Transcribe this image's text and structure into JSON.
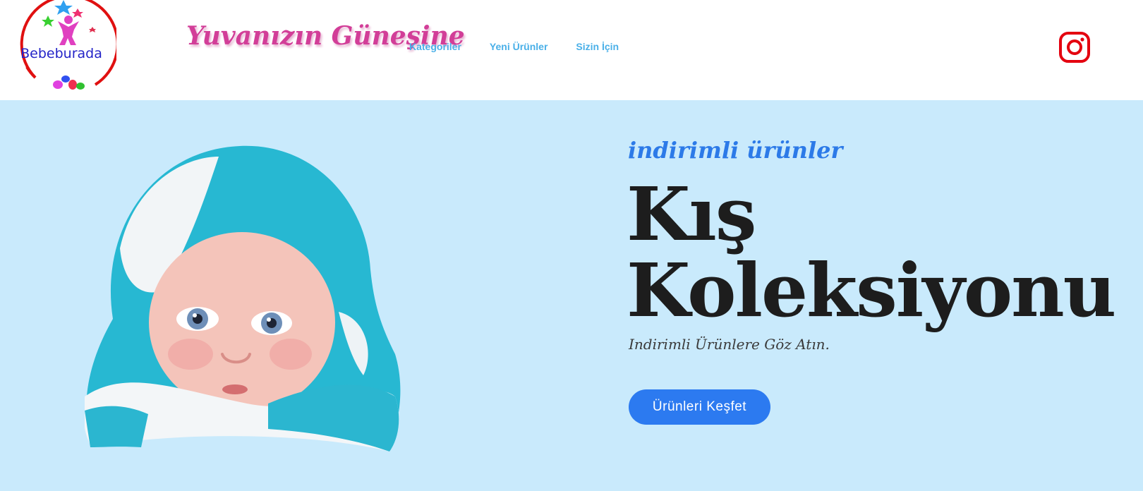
{
  "brand": {
    "logo_text": "Bebeburada",
    "tagline": "Yuvanızın Güneşine"
  },
  "nav": {
    "items": [
      {
        "label": "Kategoriler"
      },
      {
        "label": "Yeni Ürünler"
      },
      {
        "label": "Sizin İçin"
      }
    ]
  },
  "social": {
    "icon": "instagram-icon",
    "color": "#e4000f"
  },
  "hero": {
    "eyebrow": "indirimli ürünler",
    "headline_line1": "Kış",
    "headline_line2": "Koleksiyonu",
    "subhead": "Indirimli Ürünlere Göz Atın.",
    "cta_label": "Ürünleri Keşfet",
    "image_icon": "baby-in-winter-hat-image",
    "colors": {
      "background": "#c9eafc",
      "accent": "#2c7af0",
      "tagline": "#d23e98",
      "nav": "#4ab0e8"
    }
  }
}
